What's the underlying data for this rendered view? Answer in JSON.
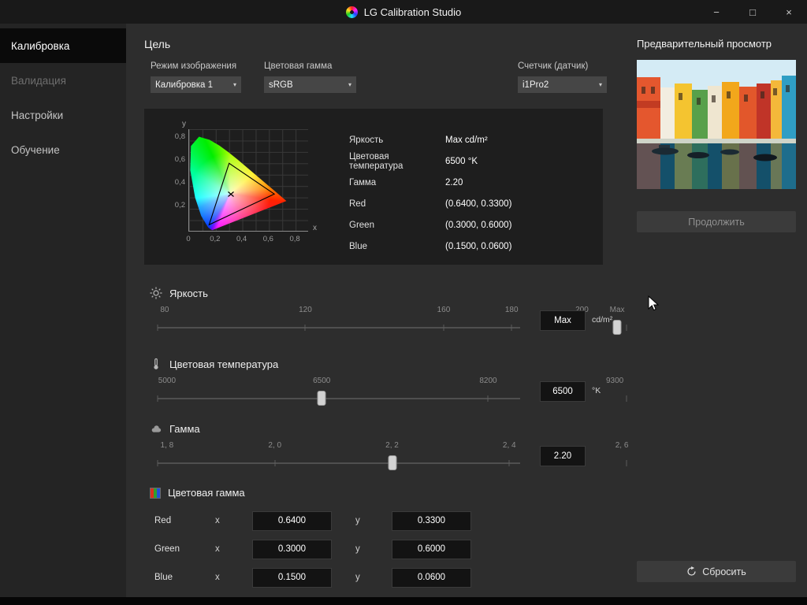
{
  "window": {
    "title": "LG Calibration Studio",
    "controls": {
      "minimize": "−",
      "maximize": "□",
      "close": "×"
    }
  },
  "sidebar": {
    "items": [
      {
        "label": "Калибровка",
        "state": "active"
      },
      {
        "label": "Валидация",
        "state": "disabled"
      },
      {
        "label": "Настройки",
        "state": "normal"
      },
      {
        "label": "Обучение",
        "state": "normal"
      }
    ]
  },
  "target": {
    "heading": "Цель",
    "picture_mode": {
      "label": "Режим изображения",
      "value": "Калибровка 1"
    },
    "color_gamut": {
      "label": "Цветовая гамма",
      "value": "sRGB"
    },
    "sensor": {
      "label": "Счетчик (датчик)",
      "value": "i1Pro2"
    },
    "info": [
      {
        "label": "Яркость",
        "value": "Max cd/m²"
      },
      {
        "label": "Цветовая температура",
        "value": "6500 °K"
      },
      {
        "label": "Гамма",
        "value": "2.20"
      },
      {
        "label": "Red",
        "value": "(0.6400, 0.3300)"
      },
      {
        "label": "Green",
        "value": "(0.3000, 0.6000)"
      },
      {
        "label": "Blue",
        "value": "(0.1500, 0.0600)"
      }
    ]
  },
  "chart": {
    "y_letter": "y",
    "x_letter": "x",
    "y_ticks": [
      "0,8",
      "0,6",
      "0,4",
      "0,2"
    ],
    "x_ticks": [
      "0",
      "0,2",
      "0,4",
      "0,6",
      "0,8"
    ]
  },
  "sliders": {
    "brightness": {
      "title": "Яркость",
      "ticks": [
        "80",
        "120",
        "160",
        "180",
        "200",
        "Max"
      ],
      "value": "Max",
      "unit": "cd/m²"
    },
    "temperature": {
      "title": "Цветовая температура",
      "ticks": [
        "5000",
        "6500",
        "8200",
        "9300"
      ],
      "value": "6500",
      "unit": "°K"
    },
    "gamma": {
      "title": "Гамма",
      "ticks": [
        "1, 8",
        "2, 0",
        "2, 2",
        "2, 4",
        "2, 6"
      ],
      "value": "2.20",
      "unit": ""
    }
  },
  "gamut": {
    "title": "Цветовая гамма",
    "axis_x": "x",
    "axis_y": "y",
    "rows": [
      {
        "label": "Red",
        "x": "0.6400",
        "y": "0.3300"
      },
      {
        "label": "Green",
        "x": "0.3000",
        "y": "0.6000"
      },
      {
        "label": "Blue",
        "x": "0.1500",
        "y": "0.0600"
      }
    ]
  },
  "preview": {
    "heading": "Предварительный просмотр",
    "continue_label": "Продолжить",
    "reset_label": "Сбросить"
  },
  "ui": {
    "chevron": "▾"
  },
  "colors": {
    "titlebar_bg": "#191919",
    "window_bg": "#2d2d2d",
    "sidebar_bg": "#242424",
    "panel_bg": "#1e1e1e",
    "input_bg": "#131313",
    "button_bg": "#3b3b3b"
  }
}
